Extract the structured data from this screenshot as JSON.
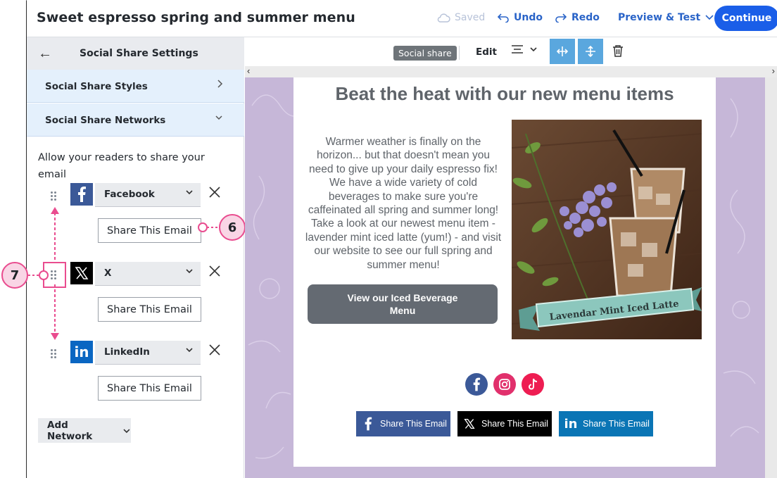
{
  "topbar": {
    "title": "Sweet espresso spring and summer menu",
    "saved": "Saved",
    "undo": "Undo",
    "redo": "Redo",
    "preview": "Preview & Test",
    "continue": "Continue"
  },
  "panel": {
    "title": "Social Share Settings",
    "accordions": [
      {
        "label": "Social Share Styles"
      },
      {
        "label": "Social Share Networks"
      }
    ],
    "intro": "Allow your readers to share your email",
    "networks": [
      {
        "name": "Facebook",
        "share_label": "Share This Email",
        "icon": "facebook-icon",
        "color": "#3b5998"
      },
      {
        "name": "X",
        "share_label": "Share This Email",
        "icon": "x-icon",
        "color": "#000000"
      },
      {
        "name": "LinkedIn",
        "share_label": "Share This Email",
        "icon": "linkedin-icon",
        "color": "#0a66c2"
      }
    ],
    "add_network": "Add Network"
  },
  "callouts": {
    "six": "6",
    "seven": "7"
  },
  "toolbar": {
    "tag": "Social share",
    "edit": "Edit"
  },
  "email": {
    "headline": "Beat the heat with our new menu items",
    "body": "Warmer weather is finally on the horizon... but that doesn't mean you need to give up your daily espresso fix! We have a wide variety of cold beverages to make sure you're caffeinated all spring and summer long! Take a look at our newest menu item - lavender mint iced latte (yum!) - and visit our website to see our full spring and summer menu!",
    "cta": "View our Iced Beverage Menu",
    "photo_banner": "Lavendar Mint Iced Latte",
    "social_icons": [
      {
        "icon": "facebook-icon",
        "color": "#3b5998"
      },
      {
        "icon": "instagram-icon",
        "color": "#e1306c"
      },
      {
        "icon": "tiktok-icon",
        "color": "#ee1d52"
      }
    ],
    "share_buttons": [
      {
        "label": "Share This Email",
        "icon": "facebook-icon",
        "color": "#3b5998"
      },
      {
        "label": "Share This Email",
        "icon": "x-icon",
        "color": "#000000"
      },
      {
        "label": "Share This Email",
        "icon": "linkedin-icon",
        "color": "#0a75b5"
      }
    ]
  },
  "colors": {
    "accent": "#1a5ee8",
    "canvas_bg": "#c6b7d8",
    "annotation": "#e94c8f"
  }
}
